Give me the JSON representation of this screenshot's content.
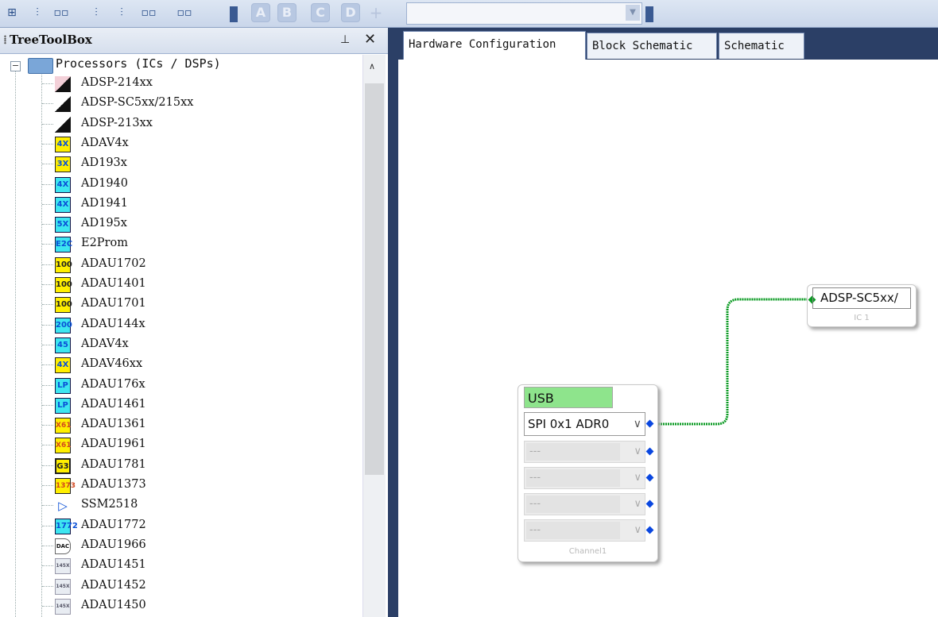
{
  "toolbar": {
    "icons": [
      "layout-icon",
      "align-top-icon",
      "distribute-h-icon",
      "align-middle-icon",
      "align-bottom-icon",
      "distribute-v-icon",
      "align-left-icon"
    ],
    "letters": [
      "A",
      "B",
      "C",
      "D"
    ],
    "add_symbol": "+"
  },
  "tree_toolbox": {
    "title": "TreeToolBox",
    "pin_glyph": "⊥",
    "close_glyph": "✕",
    "root": {
      "expander": "−",
      "label": "Processors (ICs / DSPs)"
    },
    "items": [
      {
        "label": "ADSP-214xx",
        "icon": "tri-pink",
        "badge": ""
      },
      {
        "label": "ADSP-SC5xx/215xx",
        "icon": "tri",
        "badge": ""
      },
      {
        "label": "ADSP-213xx",
        "icon": "tri",
        "badge": ""
      },
      {
        "label": "ADAV4x",
        "icon": "yel",
        "badge": "4X"
      },
      {
        "label": "AD193x",
        "icon": "yel",
        "badge": "3X"
      },
      {
        "label": "AD1940",
        "icon": "cy",
        "badge": "4X"
      },
      {
        "label": "AD1941",
        "icon": "cy",
        "badge": "4X"
      },
      {
        "label": "AD195x",
        "icon": "cy",
        "badge": "5X"
      },
      {
        "label": "E2Prom",
        "icon": "cy",
        "badge": "E2C"
      },
      {
        "label": "ADAU1702",
        "icon": "yelb",
        "badge": "100"
      },
      {
        "label": "ADAU1401",
        "icon": "yelb",
        "badge": "100"
      },
      {
        "label": "ADAU1701",
        "icon": "yelb",
        "badge": "100"
      },
      {
        "label": "ADAU144x",
        "icon": "cy",
        "badge": "200"
      },
      {
        "label": "ADAV4x",
        "icon": "cy",
        "badge": "45"
      },
      {
        "label": "ADAV46xx",
        "icon": "yel",
        "badge": "4X"
      },
      {
        "label": "ADAU176x",
        "icon": "cy",
        "badge": "LP"
      },
      {
        "label": "ADAU1461",
        "icon": "cy",
        "badge": "LP"
      },
      {
        "label": "ADAU1361",
        "icon": "chipy",
        "badge": "X61"
      },
      {
        "label": "ADAU1961",
        "icon": "chipy",
        "badge": "X61"
      },
      {
        "label": "ADAU1781",
        "icon": "g3",
        "badge": "G3"
      },
      {
        "label": "ADAU1373",
        "icon": "chipy",
        "badge": "1373"
      },
      {
        "label": "SSM2518",
        "icon": "amp",
        "badge": "▷"
      },
      {
        "label": "ADAU1772",
        "icon": "cy",
        "badge": "1772"
      },
      {
        "label": "ADAU1966",
        "icon": "dac",
        "badge": "DAC"
      },
      {
        "label": "ADAU1451",
        "icon": "gray",
        "badge": "145X"
      },
      {
        "label": "ADAU1452",
        "icon": "gray",
        "badge": "145X"
      },
      {
        "label": "ADAU1450",
        "icon": "gray",
        "badge": "145X"
      }
    ]
  },
  "tabs": [
    "Hardware Configuration",
    "Block Schematic",
    "Schematic"
  ],
  "usb_block": {
    "header": "USB",
    "selected": "SPI 0x1 ADR0",
    "empty_rows": [
      "---",
      "---",
      "---",
      "---"
    ],
    "caption": "Channel1"
  },
  "ic_block": {
    "label": "ADSP-SC5xx/",
    "caption": "IC 1"
  },
  "colors": {
    "link": "#0a9a22",
    "usb_header": "#8ee48c",
    "pin": "#0a47e0",
    "chrome": "#2b3f66"
  }
}
